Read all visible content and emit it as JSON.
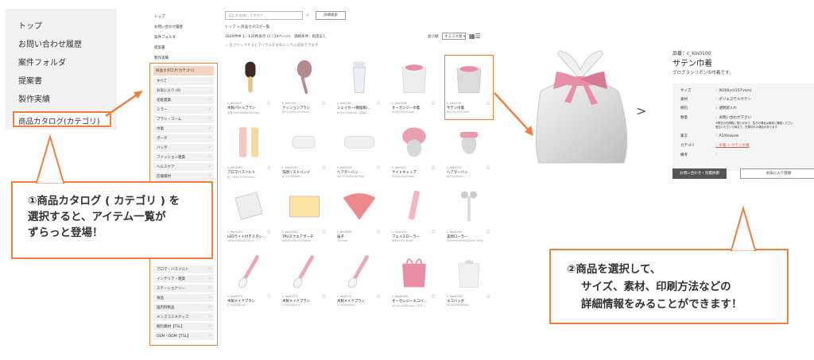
{
  "left_menu": {
    "items": [
      "トップ",
      "お問い合わせ履歴",
      "案件フォルダ",
      "提案書",
      "製作実績"
    ],
    "active": "商品カタログ(カテゴリ)"
  },
  "sidebar": {
    "top_items": [
      "トップ",
      "お問い合わせ履歴",
      "案件フォルダ",
      "提案書",
      "製作実績"
    ],
    "category_head": "商品カタログ(カテゴリ)",
    "rows": [
      "すべて",
      "お気に入り (0)",
      "化粧雑貨",
      "ミラー",
      "ブラシ・コーム",
      "巾着",
      "ポーチ",
      "バッグ",
      "ファッション雑貨",
      "ヘルスケア",
      "店舗資材"
    ],
    "bottom_rows": [
      "アロマ・バスソルト",
      "インテリア・雑貨",
      "ステーショナリー",
      "食品",
      "国内制製品",
      "メンズコスメグッズ",
      "梱包資材【TSL】",
      "OEM・ODM【TSL】"
    ]
  },
  "toolbar": {
    "search_placeholder": "なにかお探しですか？",
    "search_icon": "magnifier-icon",
    "advanced_button": "詳細検索",
    "breadcrumb": "トップ > 商品カタログ一覧",
    "counts": "1649件中 1 - 120件表示 (1 / 14ページ)　価格条件：指定なし",
    "fav_note": "☆ をクリックするとアイテムをお気に入りに追加できます",
    "sort_label": "並び順",
    "sort_value": "オススメ順 ▾",
    "view_icons": "grid-list-toggle-icon"
  },
  "products": [
    {
      "code": "c_bri0013",
      "name": "木製パドルブラシ",
      "spec": "全長250×W84×D40mm…",
      "img": "paddle-brush"
    },
    {
      "code": "c_bri0122",
      "name": "クッションブラシ",
      "spec": "W71×H37×D37mm",
      "img": "cushion-brush"
    },
    {
      "code": "c_bri0110",
      "name": "シェイカー(樹脂製)…",
      "spec": "φ73×H134mm（容量4…",
      "img": "shaker"
    },
    {
      "code": "c_kin0118",
      "name": "オーガンジー巾着",
      "spec": "W180×H250mm",
      "img": "organza-pouch"
    },
    {
      "code": "c_kin0100",
      "name": "サテン巾着",
      "spec": "W200×H157mm",
      "img": "satin-pouch",
      "selected": true
    },
    {
      "code": "c_aro0240",
      "name": "アロマバスソルト",
      "spec": "缶：W47×H107mm…",
      "img": "bath-salt"
    },
    {
      "code": "c_hea0140",
      "name": "洗顔リストバンド",
      "spec": "φ70×H80mm",
      "img": "wristband"
    },
    {
      "code": "c_hai0024",
      "name": "ヘアターバン",
      "spec": "W175×H80mm 25g",
      "img": "hair-turban"
    },
    {
      "code": "c_hai0221",
      "name": "ナイトキャップ",
      "spec": "W250×H250mm",
      "img": "night-cap"
    },
    {
      "code": "c_hai0011",
      "name": "ヘアターバン",
      "spec": "W70×H5cm",
      "img": "headband"
    },
    {
      "code": "c_mir0144",
      "name": "LEDライト付きスタン…",
      "spec": "W84×H98×D12mm",
      "img": "led-mirror"
    },
    {
      "code": "c_pou0032",
      "name": "TPUスクエアポーチ",
      "spec": "W180×H90×D70mm",
      "img": "tpu-pouch"
    },
    {
      "code": "c_aro0030",
      "name": "扇子",
      "spec": "210mm",
      "img": "folding-fan"
    },
    {
      "code": "c_rog0131",
      "name": "フェイスローラー",
      "spec": "W41×H113mm",
      "img": "face-roller"
    },
    {
      "code": "c_rog0130",
      "name": "美顔ローラー",
      "spec": "W58×H140×D44mm 103g",
      "img": "beauty-roller"
    },
    {
      "code": "c_rog0173",
      "name": "木製メイクブラシ",
      "spec": "17×D148mm",
      "img": "makeup-brush"
    },
    {
      "code": "c_rog0172",
      "name": "木製メイクブラシ",
      "spec": "17×D150mm",
      "img": "makeup-brush"
    },
    {
      "code": "c_rog0171",
      "name": "木製メイクブラシ",
      "spec": "17×D150mm",
      "img": "makeup-brush"
    },
    {
      "code": "c_bag0148",
      "name": "オーガンジーエコバ…",
      "spec": "W140×H380mm（タテ…",
      "img": "mesh-bag"
    },
    {
      "code": "c_bag0144",
      "name": "エコバッグ",
      "spec": "W320×H380mm",
      "img": "eco-bag"
    }
  ],
  "detail": {
    "code": "品番：c_kin0100",
    "title": "サテン巾着",
    "subtitle": "グログランリボンの巾着です。",
    "rows": [
      {
        "k": "サイズ",
        "v": "：W200×H157(mm)"
      },
      {
        "k": "素材",
        "v": "：ポリエステルサテン"
      },
      {
        "k": "梱包",
        "v": "：透明袋入れ"
      },
      {
        "k": "数量",
        "v": "：お問い合わせ下さい"
      },
      {
        "k": "",
        "v": "※弊社の在庫数に限りがあり、急ぎの場合は事前に確認ください"
      },
      {
        "k": "",
        "v": "受注いただいた時点で、在庫切れの場合があります"
      },
      {
        "k": "薬言",
        "v": "：A1/6ozipak"
      },
      {
        "k": "カテゴリ",
        "v": "：巾着 > サテン巾着"
      },
      {
        "k": "備考",
        "v": "："
      }
    ],
    "btn_inquiry": "お問い合わせ・見積依頼",
    "btn_favorite": "お気に入り登録"
  },
  "callout1": {
    "lines": [
      "①商品カタログ ( カテゴリ ) を",
      "選択すると、アイテム一覧が",
      "ずらっと登場！"
    ]
  },
  "callout2": {
    "lines": [
      "②商品を選択して、",
      "サイズ、素材、印刷方法などの",
      "詳細情報をみることができます！"
    ]
  },
  "colors": {
    "accent": "#f0803c",
    "satin_pink": "#e88fa6",
    "panel_bg": "#f2f2f2"
  }
}
